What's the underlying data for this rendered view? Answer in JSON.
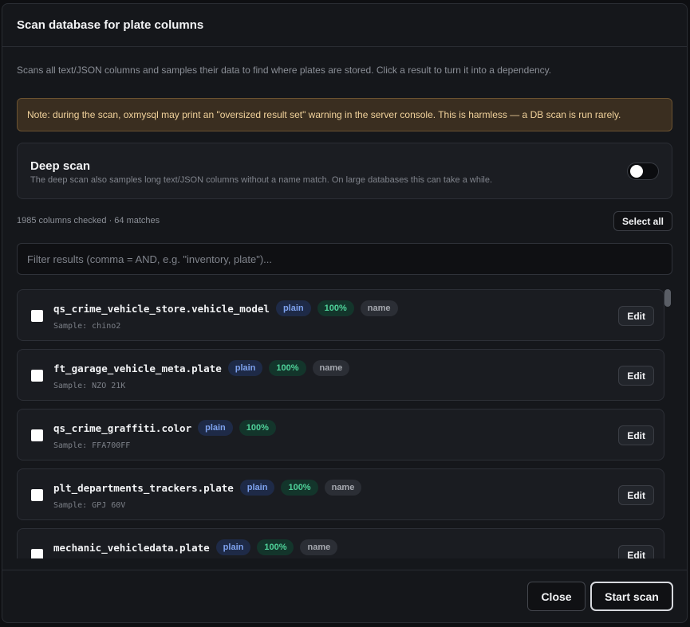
{
  "modal": {
    "title": "Scan database for plate columns",
    "description": "Scans all text/JSON columns and samples their data to find where plates are stored. Click a result to turn it into a dependency.",
    "note": "Note: during the scan, oxmysql may print an \"oversized result set\" warning in the server console. This is harmless — a DB scan is run rarely."
  },
  "deep_scan": {
    "title": "Deep scan",
    "subtitle": "The deep scan also samples long text/JSON columns without a name match. On large databases this can take a while.",
    "enabled": false
  },
  "summary": {
    "counts": "1985 columns checked · 64 matches",
    "select_all_label": "Select all"
  },
  "filter": {
    "placeholder": "Filter results (comma = AND, e.g. \"inventory, plate\")...",
    "value": ""
  },
  "results": [
    {
      "column": "qs_crime_vehicle_store.vehicle_model",
      "type": "plain",
      "confidence": "100%",
      "match": "name",
      "sample": "Sample: chino2",
      "edit_label": "Edit"
    },
    {
      "column": "ft_garage_vehicle_meta.plate",
      "type": "plain",
      "confidence": "100%",
      "match": "name",
      "sample": "Sample: NZO 21K",
      "edit_label": "Edit"
    },
    {
      "column": "qs_crime_graffiti.color",
      "type": "plain",
      "confidence": "100%",
      "match": "",
      "sample": "Sample: FFA700FF",
      "edit_label": "Edit"
    },
    {
      "column": "plt_departments_trackers.plate",
      "type": "plain",
      "confidence": "100%",
      "match": "name",
      "sample": "Sample: GPJ 60V",
      "edit_label": "Edit"
    },
    {
      "column": "mechanic_vehicledata.plate",
      "type": "plain",
      "confidence": "100%",
      "match": "name",
      "sample": "",
      "edit_label": "Edit"
    }
  ],
  "footer": {
    "close_label": "Close",
    "start_label": "Start scan"
  },
  "colors": {
    "badge_type": "#7ea2ef",
    "badge_confidence": "#4fd39a",
    "note_background": "#3a2e20"
  }
}
